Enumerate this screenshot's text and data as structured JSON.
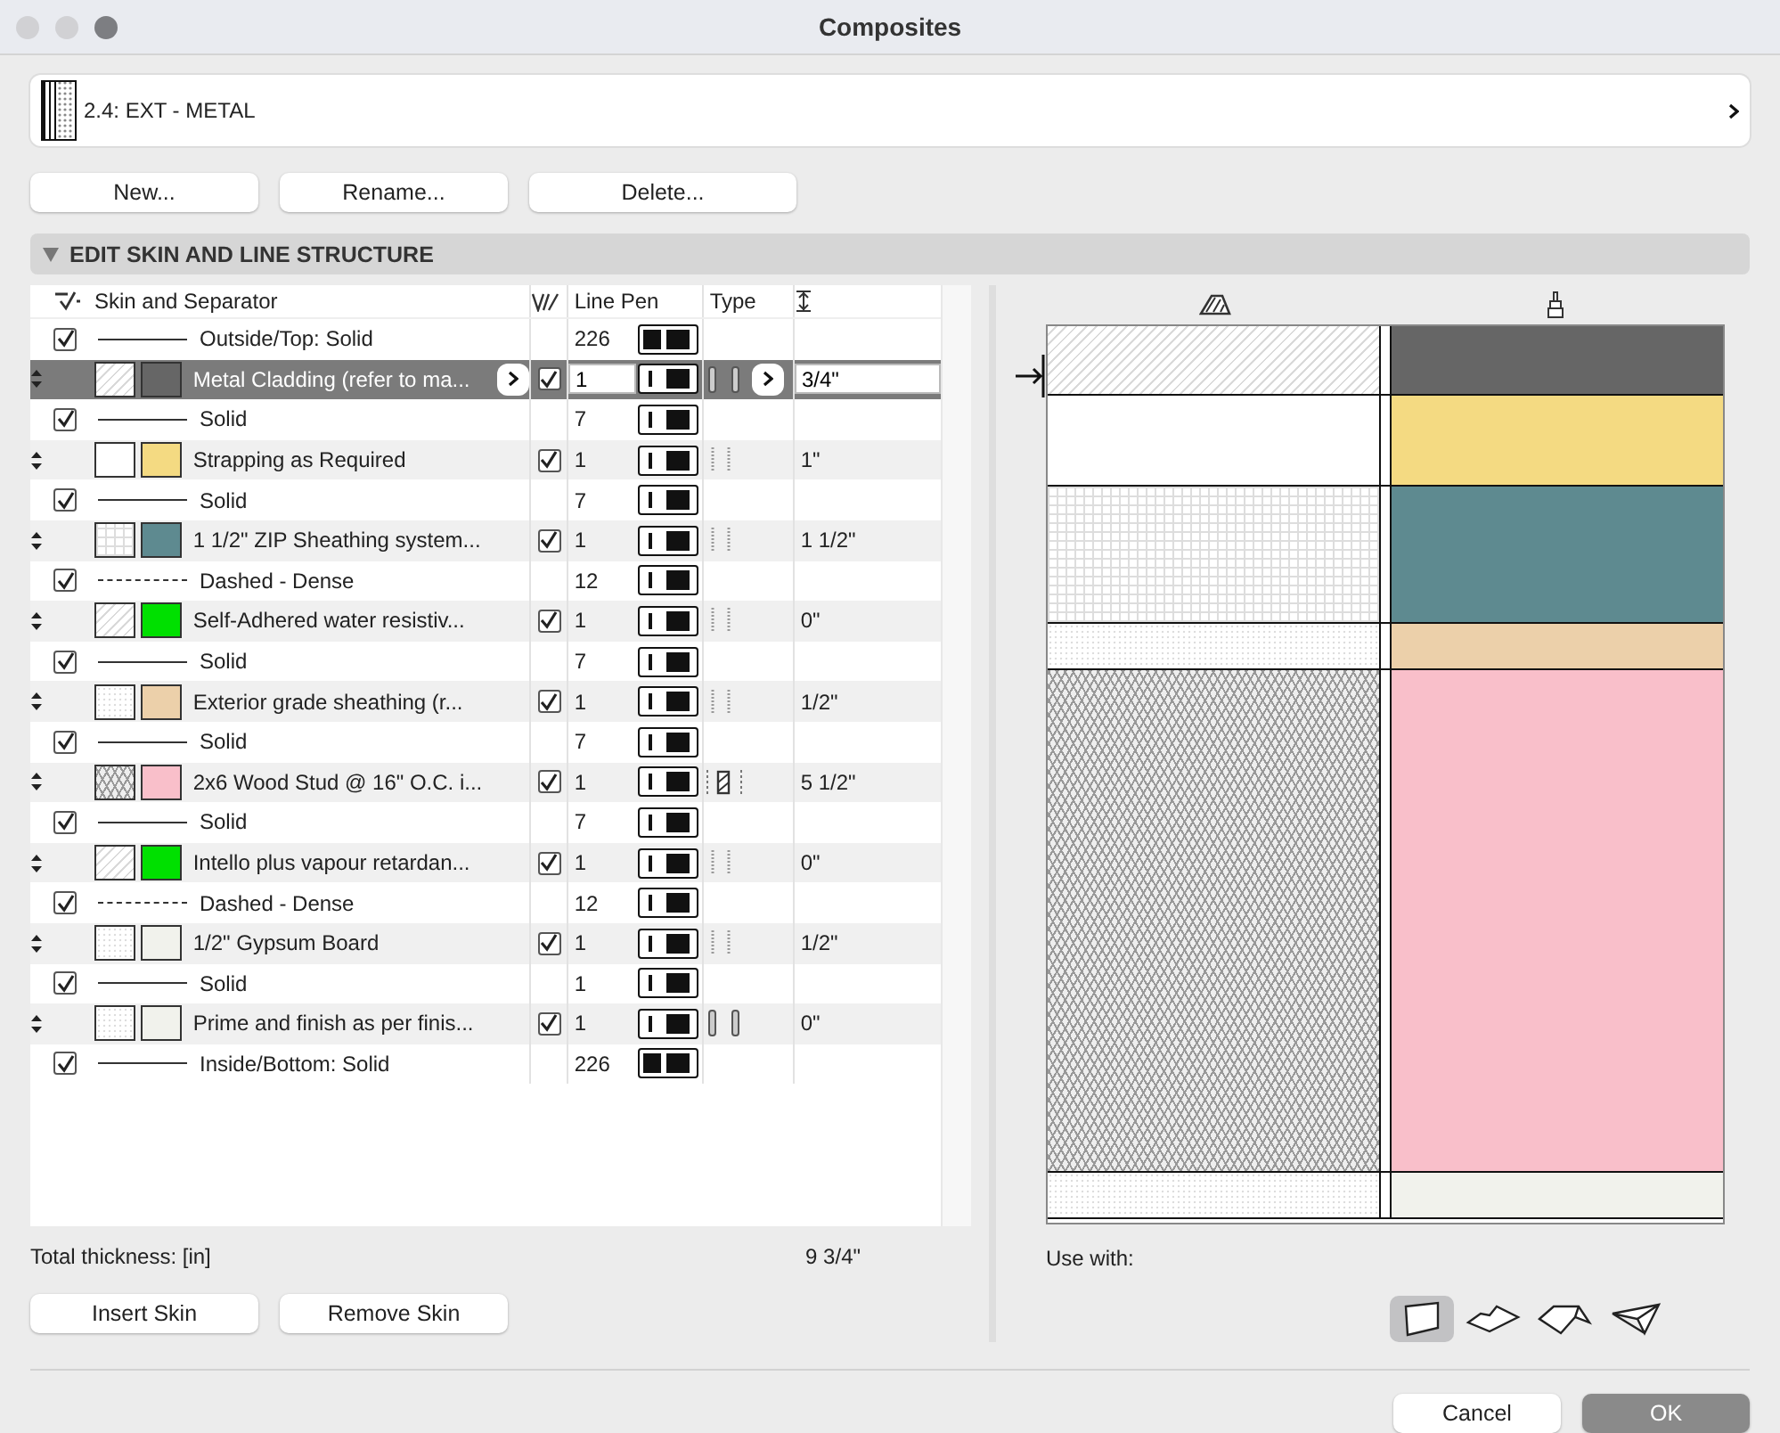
{
  "window": {
    "title": "Composites"
  },
  "composite": {
    "name": "2.4: EXT - METAL"
  },
  "actions": [
    "New...",
    "Rename...",
    "Delete..."
  ],
  "section": {
    "title": "EDIT SKIN AND LINE STRUCTURE",
    "expanded": true
  },
  "columns": {
    "name": "Skin and Separator",
    "pen": "Line Pen",
    "type": "Type"
  },
  "rows": [
    {
      "kind": "line",
      "checked": true,
      "line": {
        "kind": "solid"
      },
      "name": "Outside/Top: Solid",
      "pen": "226",
      "pen_sample": {
        "kind": "contour"
      }
    },
    {
      "kind": "skin",
      "selected": true,
      "fill": {
        "kind": "diagonal"
      },
      "color": "#666666",
      "name": "Metal Cladding (refer to ma...",
      "checked": true,
      "pen": "1",
      "skin_type": {
        "kind": "finish"
      },
      "thickness": "3/4\""
    },
    {
      "kind": "line",
      "checked": true,
      "line": {
        "kind": "solid"
      },
      "name": "Solid",
      "pen": "7",
      "pen_sample": {
        "kind": "inner"
      }
    },
    {
      "kind": "skin",
      "selected": false,
      "fill": {
        "kind": "plain"
      },
      "color": "#f4da82",
      "name": "Strapping as Required",
      "checked": true,
      "pen": "1",
      "skin_type": {
        "kind": "other"
      },
      "thickness": "1\""
    },
    {
      "kind": "line",
      "checked": true,
      "line": {
        "kind": "solid"
      },
      "name": "Solid",
      "pen": "7",
      "pen_sample": {
        "kind": "inner"
      }
    },
    {
      "kind": "skin",
      "selected": false,
      "fill": {
        "kind": "grid"
      },
      "color": "#5e8a90",
      "name": "1 1/2\" ZIP Sheathing system...",
      "checked": true,
      "pen": "1",
      "skin_type": {
        "kind": "other"
      },
      "thickness": "1 1/2\""
    },
    {
      "kind": "line",
      "checked": true,
      "line": {
        "kind": "dashed"
      },
      "name": "Dashed - Dense",
      "pen": "12",
      "pen_sample": {
        "kind": "inner"
      }
    },
    {
      "kind": "skin",
      "selected": false,
      "fill": {
        "kind": "diagonal"
      },
      "color": "#00e000",
      "name": "Self-Adhered water resistiv...",
      "checked": true,
      "pen": "1",
      "skin_type": {
        "kind": "other"
      },
      "thickness": "0\""
    },
    {
      "kind": "line",
      "checked": true,
      "line": {
        "kind": "solid"
      },
      "name": "Solid",
      "pen": "7",
      "pen_sample": {
        "kind": "inner"
      }
    },
    {
      "kind": "skin",
      "selected": false,
      "fill": {
        "kind": "dots"
      },
      "color": "#ecd0aa",
      "name": "Exterior grade sheathing (r...",
      "checked": true,
      "pen": "1",
      "skin_type": {
        "kind": "other"
      },
      "thickness": "1/2\""
    },
    {
      "kind": "line",
      "checked": true,
      "line": {
        "kind": "solid"
      },
      "name": "Solid",
      "pen": "7",
      "pen_sample": {
        "kind": "inner"
      }
    },
    {
      "kind": "skin",
      "selected": false,
      "fill": {
        "kind": "blocks"
      },
      "color": "#f9bfca",
      "name": "2x6 Wood Stud @ 16\" O.C. i...",
      "checked": true,
      "pen": "1",
      "skin_type": {
        "kind": "core"
      },
      "thickness": "5 1/2\""
    },
    {
      "kind": "line",
      "checked": true,
      "line": {
        "kind": "solid"
      },
      "name": "Solid",
      "pen": "7",
      "pen_sample": {
        "kind": "inner"
      }
    },
    {
      "kind": "skin",
      "selected": false,
      "fill": {
        "kind": "diagonal"
      },
      "color": "#00e000",
      "name": "Intello plus vapour retardan...",
      "checked": true,
      "pen": "1",
      "skin_type": {
        "kind": "other"
      },
      "thickness": "0\""
    },
    {
      "kind": "line",
      "checked": true,
      "line": {
        "kind": "dashed"
      },
      "name": "Dashed - Dense",
      "pen": "12",
      "pen_sample": {
        "kind": "inner"
      }
    },
    {
      "kind": "skin",
      "selected": false,
      "fill": {
        "kind": "dots"
      },
      "color": "#f1f2ec",
      "name": "1/2\" Gypsum Board",
      "checked": true,
      "pen": "1",
      "skin_type": {
        "kind": "other"
      },
      "thickness": "1/2\""
    },
    {
      "kind": "line",
      "checked": true,
      "line": {
        "kind": "solid"
      },
      "name": "Solid",
      "pen": "1",
      "pen_sample": {
        "kind": "inner"
      }
    },
    {
      "kind": "skin",
      "selected": false,
      "fill": {
        "kind": "dots"
      },
      "color": "#f1f2ec",
      "name": "Prime and finish as per finis...",
      "checked": true,
      "pen": "1",
      "skin_type": {
        "kind": "finish"
      },
      "thickness": "0\""
    },
    {
      "kind": "line",
      "checked": true,
      "line": {
        "kind": "solid"
      },
      "name": "Inside/Bottom: Solid",
      "pen": "226",
      "pen_sample": {
        "kind": "contour"
      }
    }
  ],
  "total": {
    "label": "Total thickness: [in]",
    "value": "9 3/4\""
  },
  "skin_buttons": [
    "Insert Skin",
    "Remove Skin"
  ],
  "use_with": {
    "label": "Use with:",
    "options": [
      {
        "kind": "wall",
        "selected": true
      },
      {
        "kind": "slab",
        "selected": false
      },
      {
        "kind": "roof",
        "selected": false
      },
      {
        "kind": "shell",
        "selected": false
      }
    ]
  },
  "footer": {
    "cancel": "Cancel",
    "ok": "OK"
  }
}
